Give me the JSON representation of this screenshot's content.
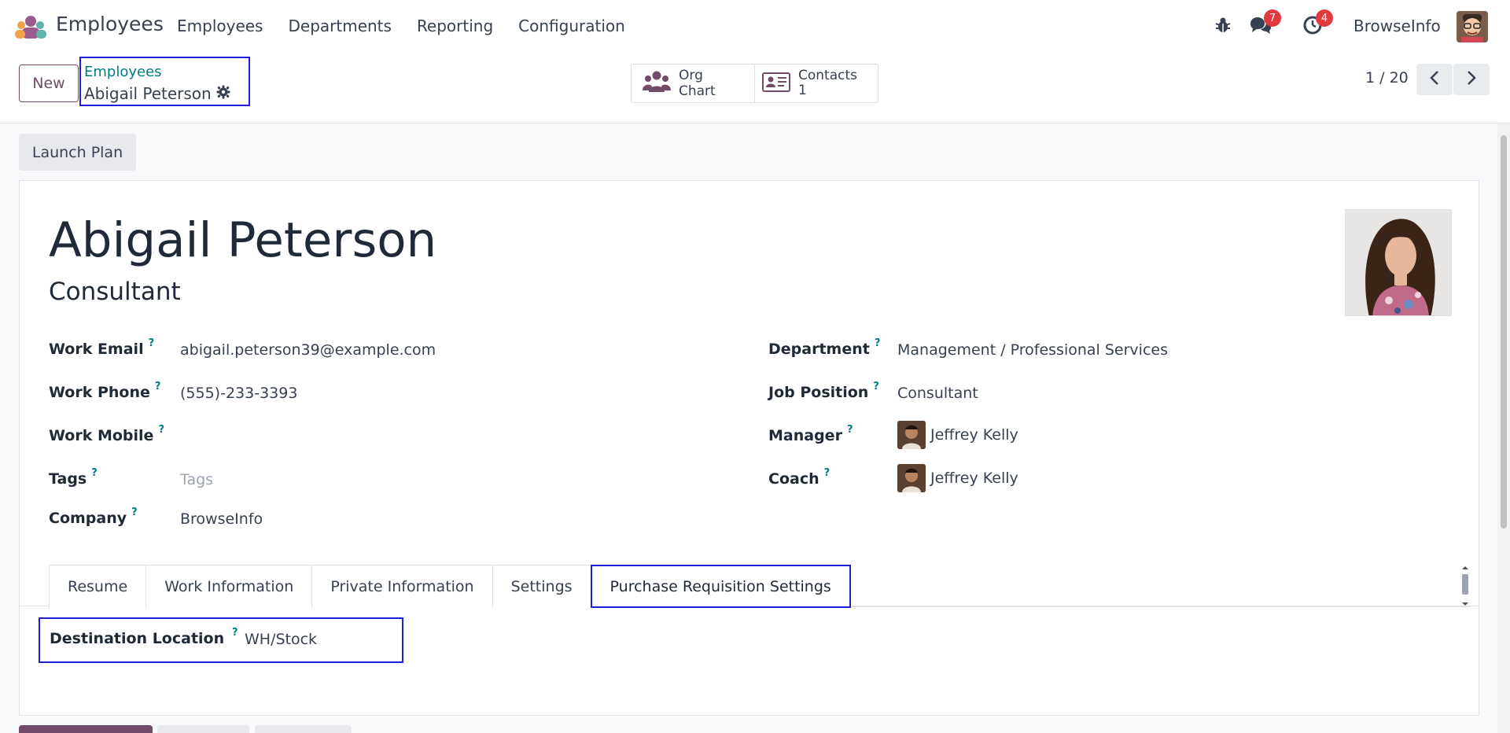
{
  "navbar": {
    "app_name": "Employees",
    "menu": [
      "Employees",
      "Departments",
      "Reporting",
      "Configuration"
    ],
    "messages_count": "7",
    "activities_count": "4",
    "company": "BrowseInfo"
  },
  "control_panel": {
    "new_label": "New",
    "breadcrumb_parent": "Employees",
    "breadcrumb_current": "Abigail Peterson",
    "org_chart_label": "Org Chart",
    "contacts_label": "Contacts",
    "contacts_count": "1",
    "pager": "1 / 20"
  },
  "launch_plan_label": "Launch Plan",
  "employee": {
    "name": "Abigail Peterson",
    "job_title": "Consultant",
    "left_fields": [
      {
        "label": "Work Email",
        "value": "abigail.peterson39@example.com"
      },
      {
        "label": "Work Phone",
        "value": "(555)-233-3393"
      },
      {
        "label": "Work Mobile",
        "value": ""
      },
      {
        "label": "Tags",
        "value": "Tags"
      },
      {
        "label": "Company",
        "value": "BrowseInfo"
      }
    ],
    "right_fields": [
      {
        "label": "Department",
        "value": "Management / Professional Services"
      },
      {
        "label": "Job Position",
        "value": "Consultant"
      },
      {
        "label": "Manager",
        "value": "Jeffrey Kelly"
      },
      {
        "label": "Coach",
        "value": "Jeffrey Kelly"
      }
    ]
  },
  "help_marker": "?",
  "tabs": [
    "Resume",
    "Work Information",
    "Private Information",
    "Settings",
    "Purchase Requisition Settings"
  ],
  "active_tab": "Purchase Requisition Settings",
  "requisition": {
    "label": "Destination Location",
    "value": "WH/Stock"
  },
  "colors": {
    "brand": "#714b67",
    "link": "#017e84",
    "highlight": "#1f1fd8",
    "badge": "#e03a3e"
  },
  "icons": [
    "app-logo-icon",
    "bug-icon",
    "chat-icon",
    "clock-icon",
    "gear-icon",
    "org-chart-icon",
    "contact-card-icon",
    "chevron-left-icon",
    "chevron-right-icon"
  ]
}
